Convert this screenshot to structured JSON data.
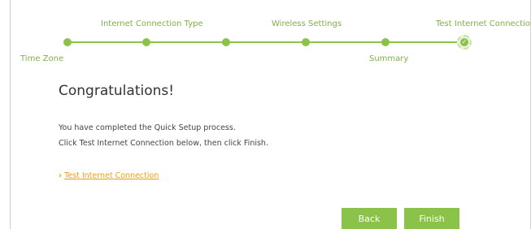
{
  "stepper": {
    "steps": [
      {
        "label": "Time Zone"
      },
      {
        "label": "Internet Connection Type"
      },
      {
        "label": "Wireless Settings"
      },
      {
        "label": "Summary"
      },
      {
        "label": "Test Internet Connection"
      }
    ],
    "current_step": 5,
    "current_icon": "check-icon"
  },
  "content": {
    "title": "Congratulations!",
    "message_line1": "You have completed the Quick Setup process.",
    "message_line2": "Click Test Internet Connection below, then click Finish.",
    "test_link_label": "Test Internet Connection",
    "link_icon": "chevron-right-icon"
  },
  "buttons": {
    "back": "Back",
    "finish": "Finish"
  },
  "colors": {
    "accent_green": "#8bc34a",
    "link_orange": "#f39c12"
  }
}
